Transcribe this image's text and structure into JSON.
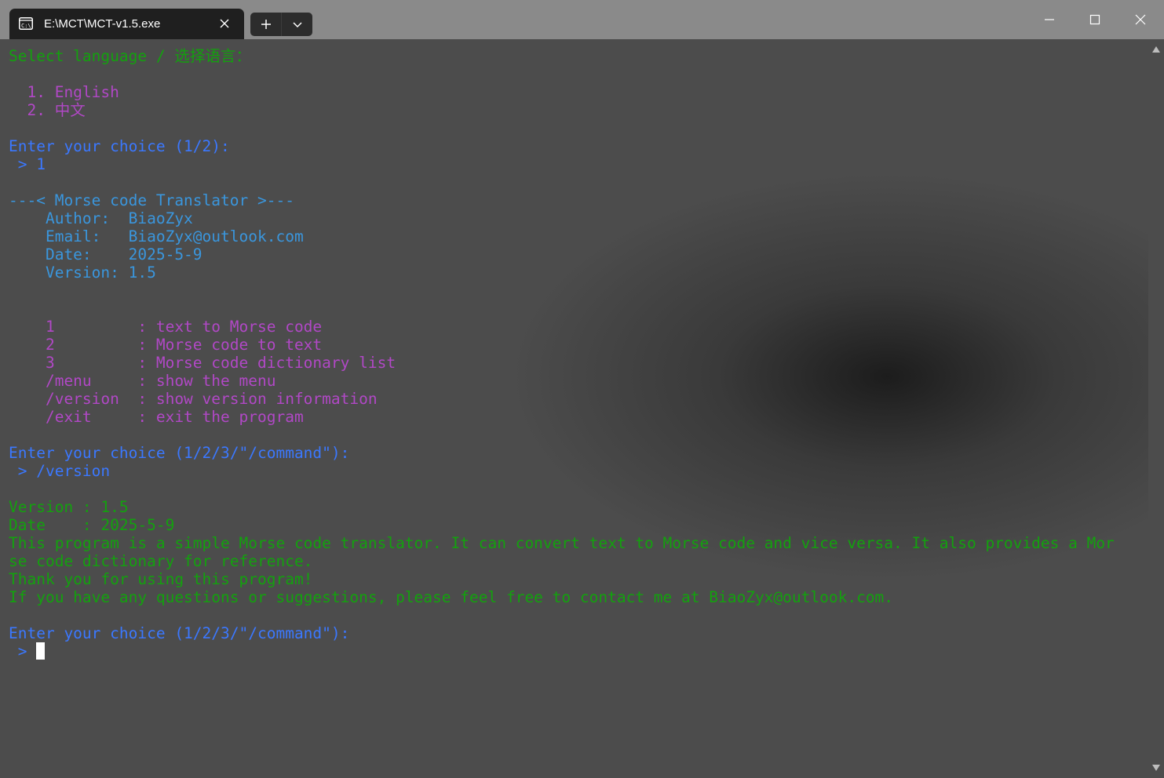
{
  "window": {
    "tab_title": "E:\\MCT\\MCT-v1.5.exe",
    "tab_icon": "console-icon",
    "new_tab_icon": "plus-icon",
    "dropdown_icon": "chevron-down-icon",
    "minimize_icon": "minimize-icon",
    "maximize_icon": "maximize-icon",
    "close_icon": "close-icon"
  },
  "colors": {
    "green": "#13a10e",
    "purple": "#b148c6",
    "blue": "#3b78ff",
    "cyan": "#3a96dd",
    "titlebar": "#8a8a8a",
    "tab_bg": "#1f1f1f"
  },
  "terminal": {
    "lines": [
      {
        "text": "Select language / 选择语言：",
        "color": "green"
      },
      {
        "text": "",
        "color": "green"
      },
      {
        "text": "  1. English",
        "color": "purple"
      },
      {
        "text": "  2. 中文",
        "color": "purple"
      },
      {
        "text": "",
        "color": "green"
      },
      {
        "text": "Enter your choice (1/2):",
        "color": "blue"
      },
      {
        "text": " > 1",
        "color": "blue"
      },
      {
        "text": "",
        "color": "green"
      },
      {
        "text": "---< Morse code Translator >---",
        "color": "cyan"
      },
      {
        "text": "    Author:  BiaoZyx",
        "color": "cyan"
      },
      {
        "text": "    Email:   BiaoZyx@outlook.com",
        "color": "cyan"
      },
      {
        "text": "    Date:    2025-5-9",
        "color": "cyan"
      },
      {
        "text": "    Version: 1.5",
        "color": "cyan"
      },
      {
        "text": "",
        "color": "green"
      },
      {
        "text": "",
        "color": "green"
      },
      {
        "text": "    1         : text to Morse code",
        "color": "purple"
      },
      {
        "text": "    2         : Morse code to text",
        "color": "purple"
      },
      {
        "text": "    3         : Morse code dictionary list",
        "color": "purple"
      },
      {
        "text": "    /menu     : show the menu",
        "color": "purple"
      },
      {
        "text": "    /version  : show version information",
        "color": "purple"
      },
      {
        "text": "    /exit     : exit the program",
        "color": "purple"
      },
      {
        "text": "",
        "color": "green"
      },
      {
        "text": "Enter your choice (1/2/3/\"/command\"):",
        "color": "blue"
      },
      {
        "text": " > /version",
        "color": "blue"
      },
      {
        "text": "",
        "color": "green"
      },
      {
        "text": "Version : 1.5",
        "color": "green"
      },
      {
        "text": "Date    : 2025-5-9",
        "color": "green"
      },
      {
        "text": "This program is a simple Morse code translator. It can convert text to Morse code and vice versa. It also provides a Mor",
        "color": "green"
      },
      {
        "text": "se code dictionary for reference.",
        "color": "green"
      },
      {
        "text": "Thank you for using this program!",
        "color": "green"
      },
      {
        "text": "If you have any questions or suggestions, please feel free to contact me at BiaoZyx@outlook.com.",
        "color": "green"
      },
      {
        "text": "",
        "color": "green"
      },
      {
        "text": "Enter your choice (1/2/3/\"/command\"):",
        "color": "blue"
      }
    ],
    "prompt": " > ",
    "prompt_color": "blue"
  }
}
